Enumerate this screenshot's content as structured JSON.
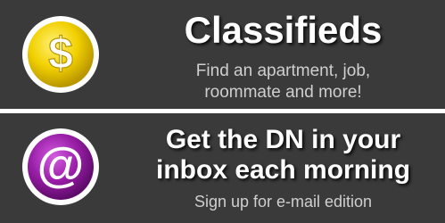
{
  "classifieds": {
    "icon": "dollar-icon",
    "glyph": "$",
    "badge_color": "#e8c400",
    "title": "Classifieds",
    "subtitle_line1": "Find an apartment, job,",
    "subtitle_line2": "roommate and more!"
  },
  "email": {
    "icon": "at-sign-icon",
    "glyph": "@",
    "badge_color": "#8b1a9a",
    "title_line1": "Get the DN in your",
    "title_line2": "inbox each morning",
    "subtitle": "Sign up for e-mail edition"
  }
}
